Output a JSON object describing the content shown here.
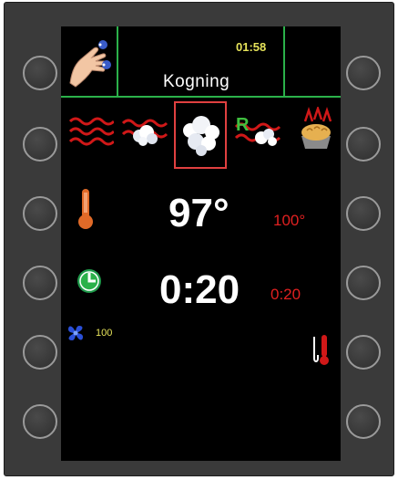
{
  "header": {
    "clock": "01:58",
    "mode_title": "Kogning"
  },
  "modes": [
    {
      "name": "hot-air",
      "icon": "heat-waves-icon",
      "selected": false
    },
    {
      "name": "combi",
      "icon": "combi-steam-heat-icon",
      "selected": false
    },
    {
      "name": "steam",
      "icon": "steam-cloud-icon",
      "selected": true
    },
    {
      "name": "regeneration",
      "icon": "regeneration-icon",
      "selected": false
    },
    {
      "name": "proofing",
      "icon": "bread-proofing-icon",
      "selected": false
    }
  ],
  "regen_letter": "R",
  "temperature": {
    "actual": "97°",
    "setpoint": "100°",
    "icon": "thermometer-icon"
  },
  "timer": {
    "actual": "0:20",
    "setpoint": "0:20",
    "icon": "clock-icon"
  },
  "fan": {
    "value": "100",
    "icon": "fan-icon"
  },
  "probe": {
    "icon": "core-probe-icon"
  },
  "colors": {
    "accent_green": "#2bb14a",
    "setpoint_red": "#e02020",
    "clock_yellow": "#e6e35a",
    "selection_red": "#e04040"
  }
}
